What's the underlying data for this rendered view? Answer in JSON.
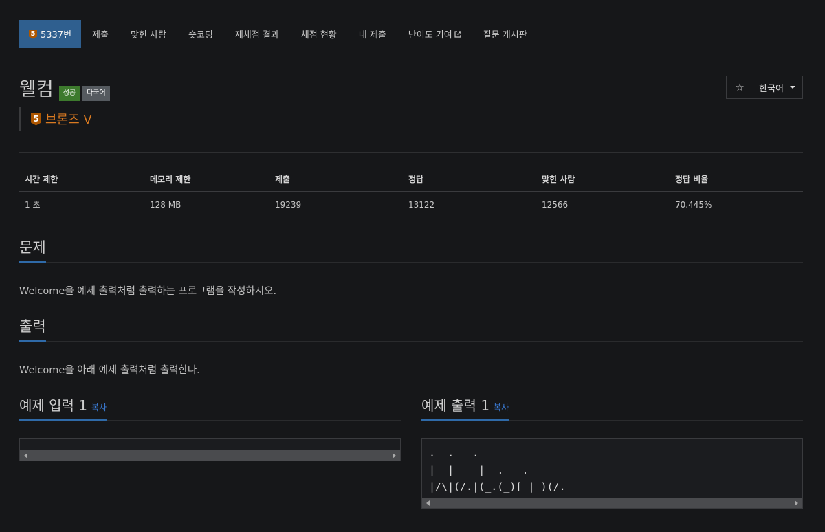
{
  "nav": {
    "problem_tier": "5",
    "problem_number": "5337번",
    "items": [
      "제출",
      "맞힌 사람",
      "숏코딩",
      "재채점 결과",
      "채점 현황",
      "내 제출",
      "난이도 기여",
      "질문 게시판"
    ]
  },
  "problem": {
    "title": "웰컴",
    "labels": [
      "성공",
      "다국어"
    ],
    "tier_number": "5",
    "tier_name": "브론즈 V",
    "star": "☆",
    "language": "한국어"
  },
  "info_table": {
    "headers": [
      "시간 제한",
      "메모리 제한",
      "제출",
      "정답",
      "맞힌 사람",
      "정답 비율"
    ],
    "values": [
      "1 초",
      "128 MB",
      "19239",
      "13122",
      "12566",
      "70.445%"
    ]
  },
  "sections": {
    "problem_heading": "문제",
    "problem_text": "Welcome을 예제 출력처럼 출력하는 프로그램을 작성하시오.",
    "output_heading": "출력",
    "output_text": "Welcome을 아래 예제 출력처럼 출력한다."
  },
  "samples": {
    "input_heading": "예제 입력 1",
    "output_heading": "예제 출력 1",
    "copy_label": "복사",
    "output_lines": [
      ".  .   .",
      "|  |  _ | _. _ ._ _  _",
      "|/\\|(/.|(_.(_)[ | )(/."
    ]
  },
  "colors": {
    "accent": "#2f5f8f",
    "bronze": "#ad5600",
    "success": "#3d7a2d"
  }
}
